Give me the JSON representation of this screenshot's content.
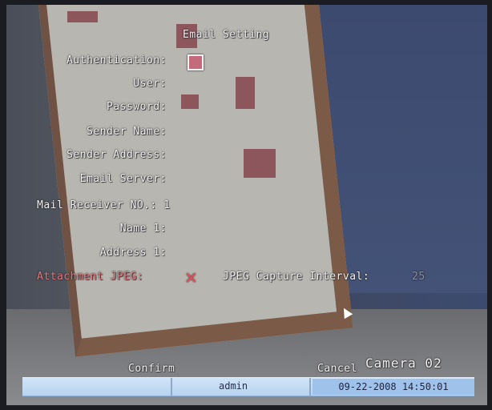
{
  "dialog": {
    "title": "Email Setting",
    "fields": [
      {
        "label": "Authentication:"
      },
      {
        "label": "User:"
      },
      {
        "label": "Password:"
      },
      {
        "label": "Sender Name:"
      },
      {
        "label": "Sender Address:"
      },
      {
        "label": "Email Server:"
      },
      {
        "label": "Mail Receiver NO.: 1"
      },
      {
        "label": "Name 1:"
      },
      {
        "label": "Address 1:"
      }
    ],
    "attachment_label": "Attachment JPEG:",
    "attachment_value": "✕",
    "interval_label": "JPEG Capture Interval:",
    "interval_value": "25",
    "confirm_label": "Confirm",
    "cancel_label": "Cancel"
  },
  "camera_label": "Camera 02",
  "status": {
    "user": "admin",
    "datetime": "09-22-2008 14:50:01"
  }
}
